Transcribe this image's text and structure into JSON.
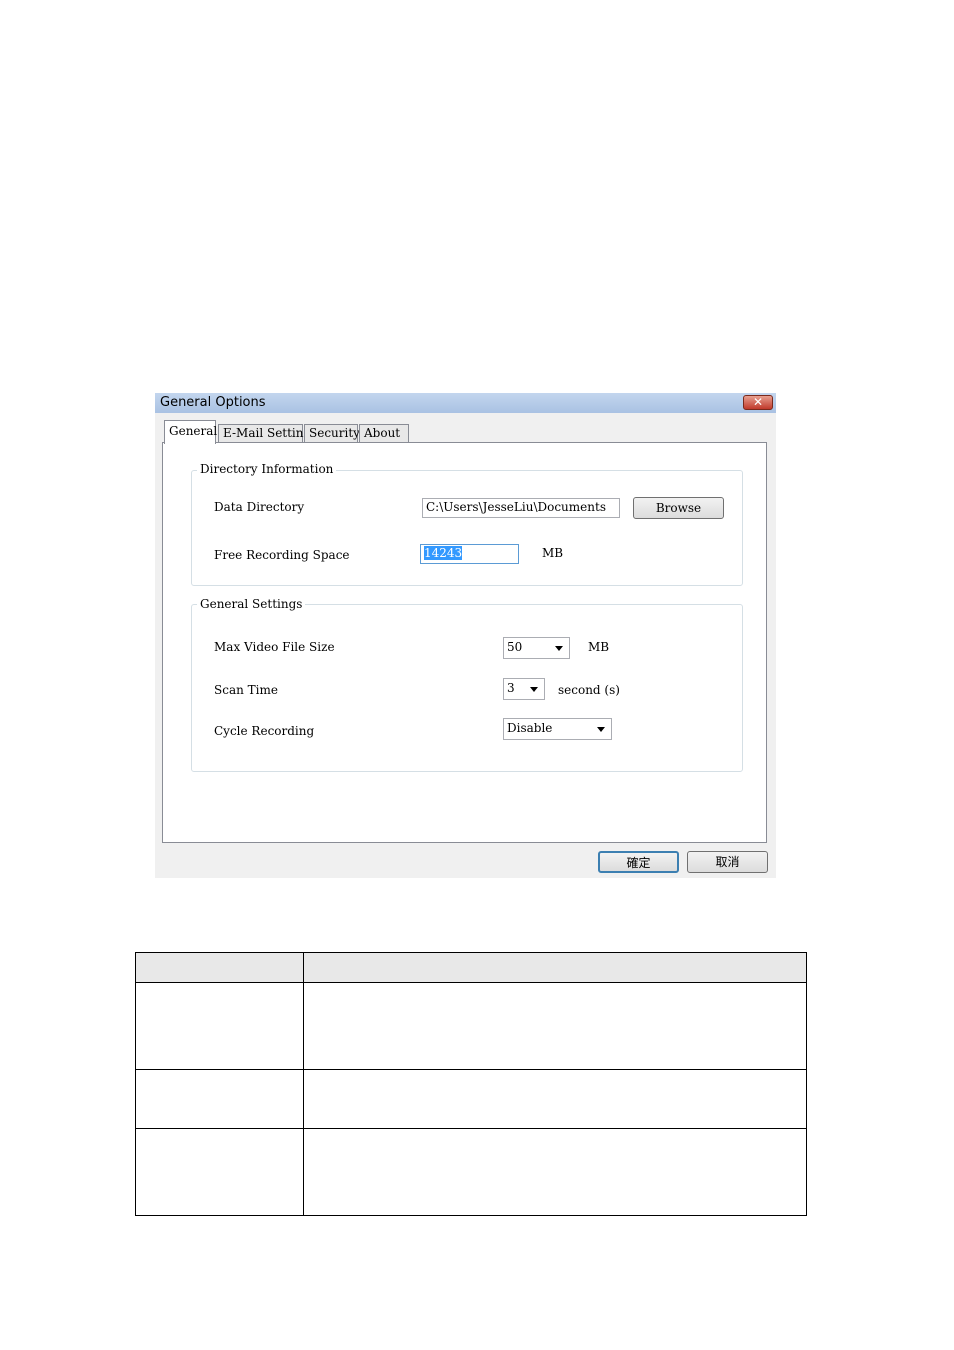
{
  "window": {
    "title": "General Options",
    "close_label": "✕"
  },
  "tabs": [
    {
      "label": "General",
      "active": true
    },
    {
      "label": "E-Mail Setting",
      "active": false
    },
    {
      "label": "Security",
      "active": false
    },
    {
      "label": "About",
      "active": false
    }
  ],
  "directory_group": {
    "legend": "Directory Information",
    "data_directory_label": "Data Directory",
    "data_directory_value": "C:\\Users\\JesseLiu\\Documents",
    "browse_label": "Browse",
    "free_space_label": "Free Recording Space",
    "free_space_value": "14243",
    "free_space_unit": "MB"
  },
  "general_group": {
    "legend": "General Settings",
    "max_size_label": "Max Video File Size",
    "max_size_value": "50",
    "max_size_unit": "MB",
    "scan_time_label": "Scan Time",
    "scan_time_value": "3",
    "scan_time_unit": "second (s)",
    "cycle_label": "Cycle Recording",
    "cycle_value": "Disable"
  },
  "footer": {
    "ok_label": "確定",
    "cancel_label": "取消"
  },
  "colors": {
    "titlebar": "#b4cbe8",
    "highlight": "#3399ff",
    "ok_border": "#3c7fb1"
  }
}
